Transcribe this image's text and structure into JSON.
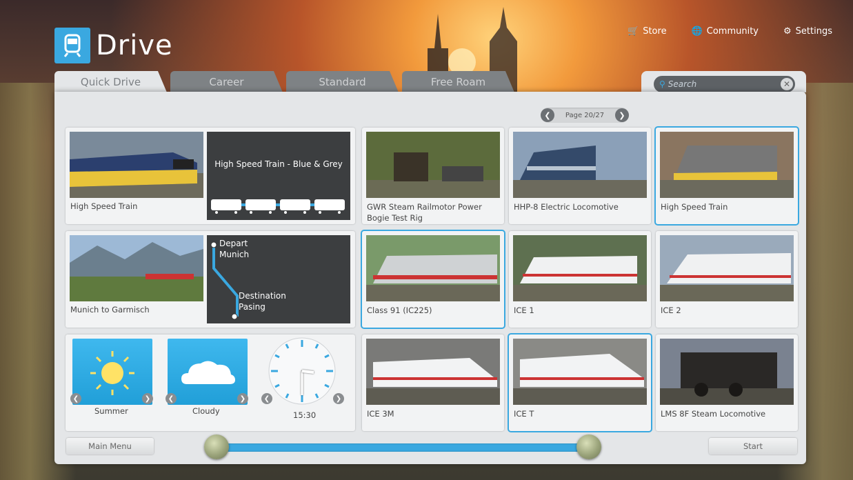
{
  "app": {
    "title": "Drive"
  },
  "topnav": {
    "store": "Store",
    "community": "Community",
    "settings": "Settings"
  },
  "tabs": [
    "Quick Drive",
    "Career",
    "Standard",
    "Free Roam"
  ],
  "search": {
    "placeholder": "Search"
  },
  "pager": {
    "label": "Page 20/27"
  },
  "selection": {
    "train_card": {
      "caption": "High Speed Train",
      "title": "High Speed Train - Blue & Grey"
    },
    "route_card": {
      "caption": "Munich to Garmisch",
      "depart_label": "Depart",
      "depart": "Munich",
      "dest_label": "Destination",
      "dest": "Pasing"
    },
    "weather": {
      "season": "Summer",
      "condition": "Cloudy",
      "time": "15:30"
    }
  },
  "trains": [
    {
      "caption": "GWR Steam Railmotor Power Bogie Test Rig",
      "selected": false
    },
    {
      "caption": "HHP-8 Electric Locomotive",
      "selected": false
    },
    {
      "caption": "High Speed Train",
      "selected": true
    },
    {
      "caption": "Class 91 (IC225)",
      "selected": true
    },
    {
      "caption": "ICE 1",
      "selected": false
    },
    {
      "caption": "ICE 2",
      "selected": false
    },
    {
      "caption": "ICE 3M",
      "selected": false
    },
    {
      "caption": "ICE T",
      "selected": true
    },
    {
      "caption": "LMS 8F Steam Locomotive",
      "selected": false
    }
  ],
  "bottom": {
    "main_menu": "Main Menu",
    "start": "Start"
  },
  "colors": {
    "accent": "#3aa8e0",
    "panel": "#e4e6e8",
    "tab_inactive": "#7e8285"
  }
}
